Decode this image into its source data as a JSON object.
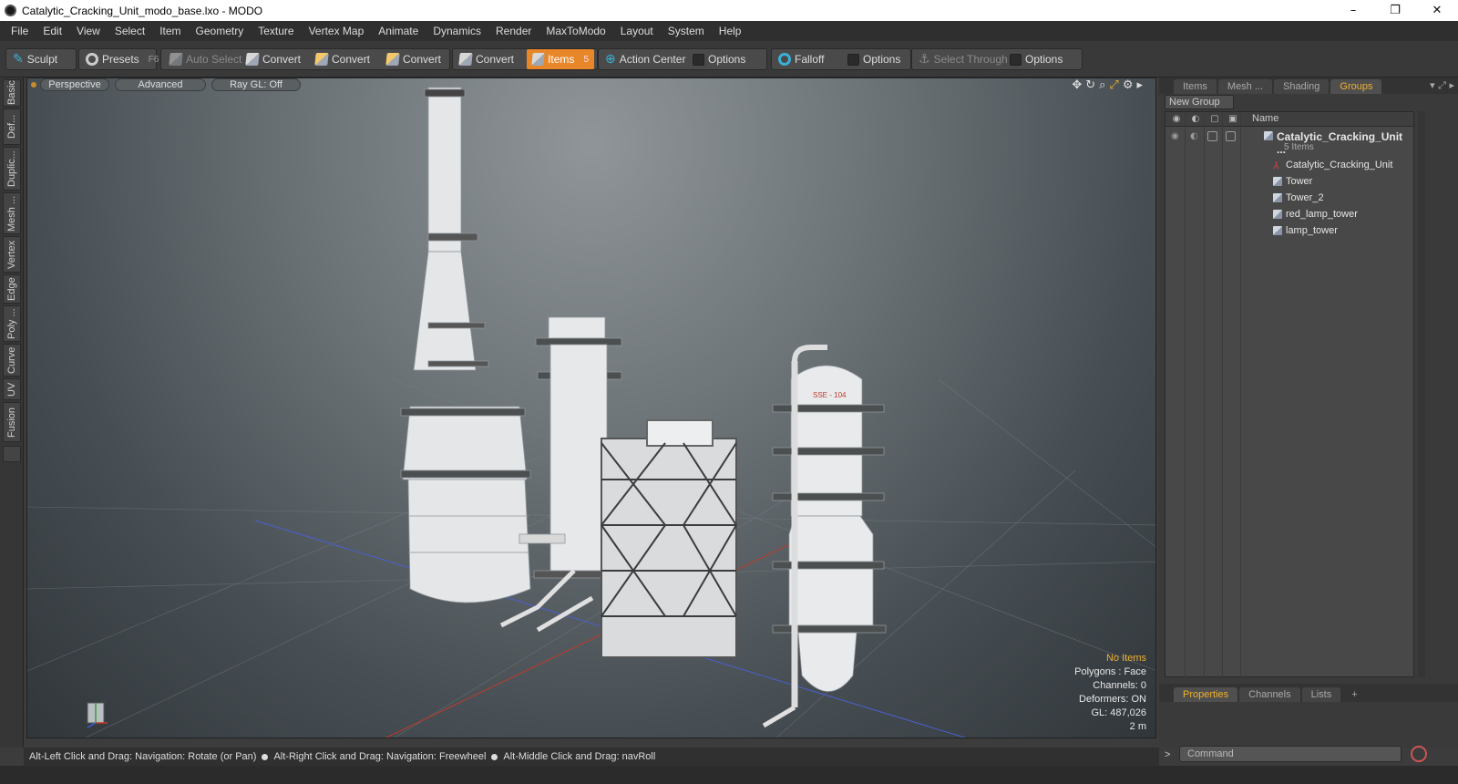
{
  "window": {
    "title": "Catalytic_Cracking_Unit_modo_base.lxo - MODO",
    "controls": [
      "–",
      "❐",
      "✕"
    ]
  },
  "menu": [
    "File",
    "Edit",
    "View",
    "Select",
    "Item",
    "Geometry",
    "Texture",
    "Vertex Map",
    "Animate",
    "Dynamics",
    "Render",
    "MaxToModo",
    "Layout",
    "System",
    "Help"
  ],
  "toolbar": {
    "sculpt": "Sculpt",
    "presets": "Presets",
    "presets_key": "F6",
    "auto_select": "Auto Select",
    "convert1": "Convert",
    "convert2": "Convert",
    "convert3": "Convert",
    "convert4": "Convert",
    "items": "Items",
    "items_key": "5",
    "action_center": "Action Center",
    "options1": "Options",
    "falloff": "Falloff",
    "options2": "Options",
    "select_through": "Select Through",
    "options3": "Options"
  },
  "left_tabs": [
    "Basic",
    "Def...",
    "Duplic...",
    "Mesh ...",
    "Vertex",
    "Edge",
    "Poly ...",
    "Curve",
    "UV",
    "Fusion"
  ],
  "viewport": {
    "view_mode": "Perspective",
    "shading": "Advanced",
    "raygl": "Ray GL: Off",
    "stats": {
      "selection": "No Items",
      "polygons": "Polygons : Face",
      "channels": "Channels: 0",
      "deformers": "Deformers: ON",
      "gl": "GL: 487,026",
      "scale": "2 m"
    },
    "tower_label": "SSE - 104"
  },
  "status": {
    "hint1": "Alt-Left Click and Drag: Navigation: Rotate (or Pan)",
    "hint2": "Alt-Right Click and Drag: Navigation: Freewheel",
    "hint3": "Alt-Middle Click and Drag: navRoll"
  },
  "right_panel": {
    "tabs": [
      "Items",
      "Mesh ...",
      "Shading",
      "Groups"
    ],
    "active_tab": "Groups",
    "new_group": "New Group",
    "column_name": "Name",
    "group_name": "Catalytic_Cracking_Unit ...",
    "group_count": "5 Items",
    "items": [
      "Catalytic_Cracking_Unit",
      "Tower",
      "Tower_2",
      "red_lamp_tower",
      "lamp_tower"
    ],
    "bottom_tabs": [
      "Properties",
      "Channels",
      "Lists",
      "+"
    ],
    "active_bottom_tab": "Properties",
    "command_placeholder": "Command",
    "command_prompt": ">"
  },
  "colors": {
    "accent": "#e8872a",
    "active_tab_text": "#f0b030",
    "falloff": "#3bb0d6"
  }
}
